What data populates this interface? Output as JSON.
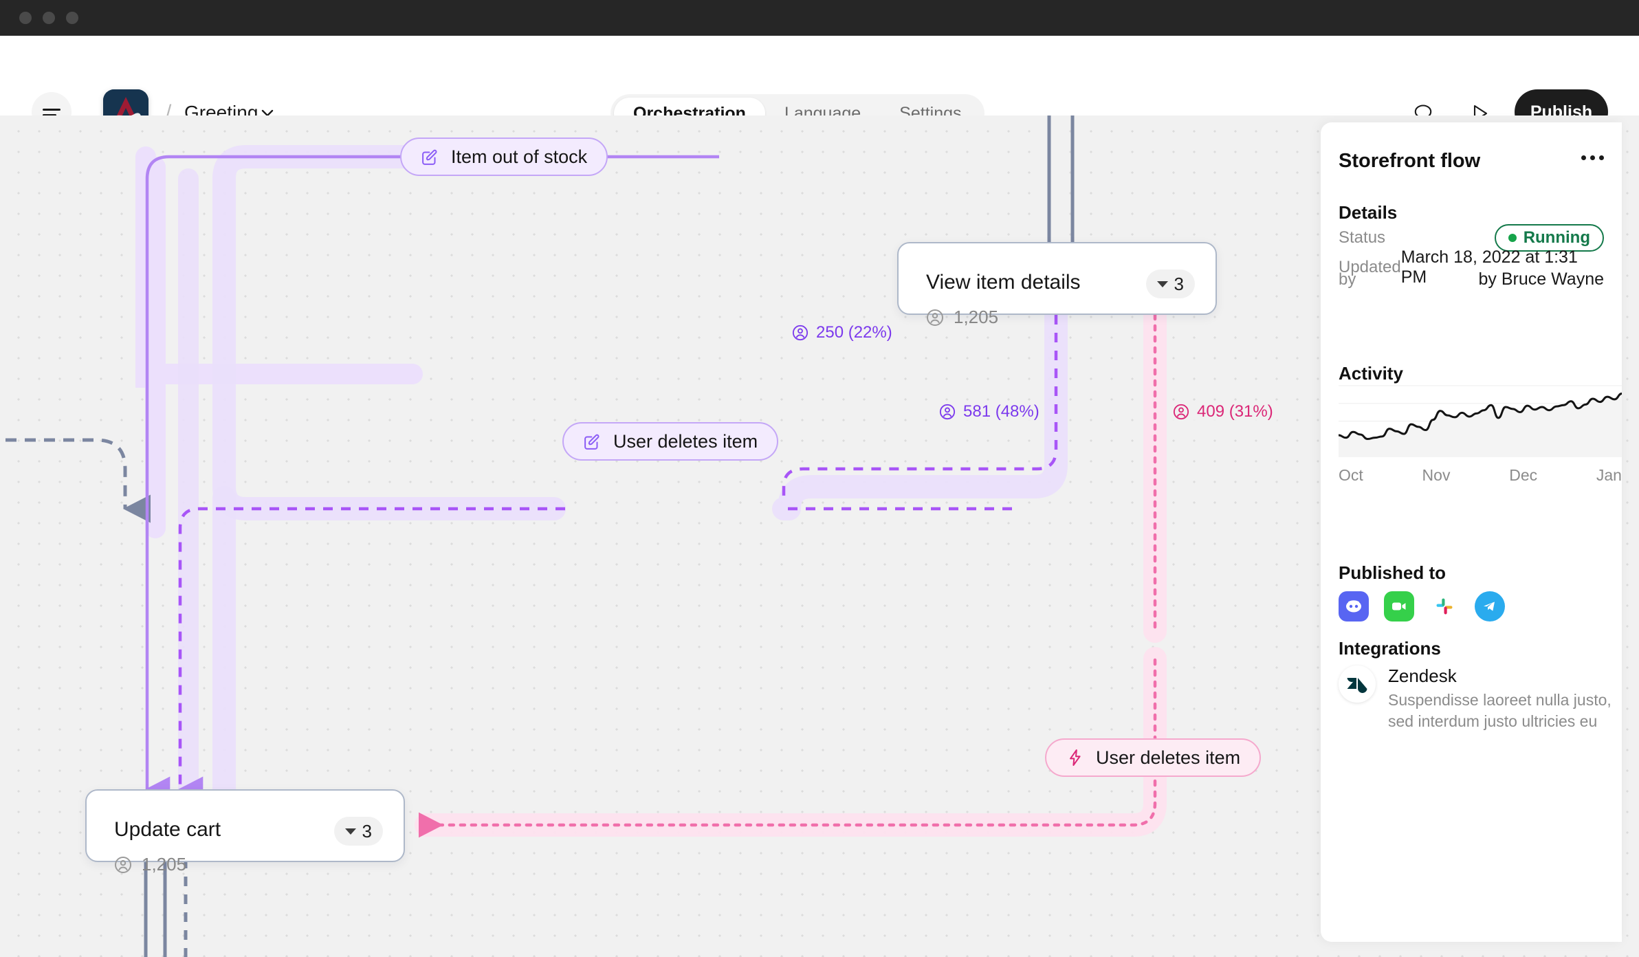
{
  "window": {
    "dots": [
      "close",
      "minimize",
      "maximize"
    ]
  },
  "header": {
    "menu_icon": "hamburger-icon",
    "logo_icon": "colorado-avalanche-logo",
    "breadcrumb_separator": "/",
    "breadcrumb_name": "Greeting",
    "breadcrumb_caret_icon": "chevron-down-icon",
    "tabs": [
      {
        "label": "Orchestration",
        "active": true
      },
      {
        "label": "Language",
        "active": false
      },
      {
        "label": "Settings",
        "active": false
      }
    ],
    "comment_icon": "comment-icon",
    "play_icon": "play-icon",
    "publish_label": "Publish"
  },
  "flow": {
    "nodes": [
      {
        "id": "view-item-details",
        "type": "card",
        "title": "View item details",
        "count_pill": "3",
        "meta_icon": "user-circle-icon",
        "meta_value": "1,205"
      },
      {
        "id": "update-cart",
        "type": "card",
        "title": "Update cart",
        "count_pill": "3",
        "meta_icon": "user-circle-icon",
        "meta_value": "1,205"
      },
      {
        "id": "item-out-of-stock",
        "type": "pill",
        "color": "purple",
        "icon": "edit-square-icon",
        "label": "Item out of stock"
      },
      {
        "id": "user-deletes-item-purple",
        "type": "pill",
        "color": "purple",
        "icon": "edit-square-icon",
        "label": "User deletes item"
      },
      {
        "id": "user-deletes-item-pink",
        "type": "pill",
        "color": "pink",
        "icon": "lightning-bolt-icon",
        "label": "User deletes item"
      }
    ],
    "edge_labels": [
      {
        "id": "edge-250",
        "icon": "user-circle-icon",
        "text": "250 (22%)",
        "color": "purple"
      },
      {
        "id": "edge-581",
        "icon": "user-circle-icon",
        "text": "581 (48%)",
        "color": "purple"
      },
      {
        "id": "edge-409",
        "icon": "user-circle-icon",
        "text": "409 (31%)",
        "color": "pink"
      }
    ],
    "colors": {
      "purple": "#7c3aed",
      "purple_light": "#c4a7f7",
      "pink": "#db2777",
      "pink_light": "#f5a9cd",
      "gray": "#7b86a0"
    }
  },
  "panel": {
    "title": "Storefront flow",
    "more_icon": "ellipsis-icon",
    "details_heading": "Details",
    "status_label": "Status",
    "status_value": "Running",
    "status_color": "#14794a",
    "updated_label": "Updated",
    "updated_value": "March 18, 2022 at 1:31 PM",
    "by_label": "by",
    "by_value": "by Bruce Wayne",
    "activity_heading": "Activity",
    "published_heading": "Published to",
    "published_icons": [
      "discord-icon",
      "facetime-icon",
      "slack-icon",
      "telegram-icon"
    ],
    "integrations_heading": "Integrations",
    "integrations": [
      {
        "logo": "zendesk-logo",
        "name": "Zendesk",
        "description": "Suspendisse laoreet nulla justo, sed interdum justo ultricies eu"
      }
    ]
  },
  "chart_data": {
    "type": "area",
    "title": "Activity",
    "xlabel": "",
    "ylabel": "",
    "tick_labels": [
      "Oct",
      "Nov",
      "Dec",
      "Jan"
    ],
    "grid": true,
    "legend": "none",
    "ylim": [
      0,
      100
    ],
    "x": [
      0,
      1,
      2,
      3,
      4,
      5,
      6,
      7,
      8,
      9,
      10,
      11,
      12,
      13,
      14,
      15,
      16,
      17,
      18,
      19,
      20,
      21,
      22,
      23,
      24,
      25,
      26,
      27,
      28,
      29,
      30,
      31,
      32,
      33,
      34,
      35,
      36,
      37,
      38,
      39
    ],
    "values": [
      28,
      24,
      33,
      29,
      22,
      24,
      26,
      38,
      34,
      30,
      45,
      41,
      36,
      52,
      66,
      59,
      56,
      63,
      57,
      62,
      67,
      75,
      55,
      72,
      69,
      64,
      74,
      68,
      72,
      67,
      73,
      75,
      81,
      70,
      76,
      85,
      80,
      88,
      84,
      93
    ]
  }
}
